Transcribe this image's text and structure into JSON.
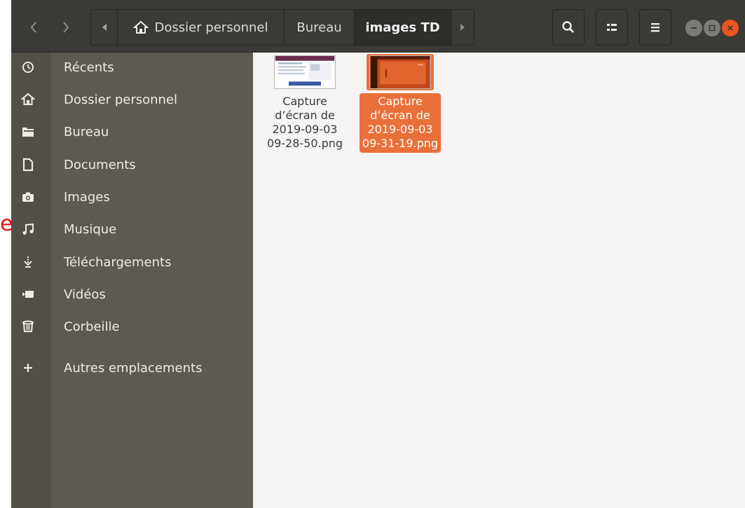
{
  "stray_text": "e",
  "header": {
    "back_label": "‹",
    "forward_label": "›",
    "path": [
      {
        "label": "Dossier personnel"
      },
      {
        "label": "Bureau"
      },
      {
        "label": "images TD"
      }
    ],
    "icons": {
      "search": "search-icon",
      "view": "view-toggle-icon",
      "menu": "hamburger-menu-icon"
    }
  },
  "sidebar": {
    "items": [
      {
        "label": "Récents",
        "icon": "clock-icon"
      },
      {
        "label": "Dossier personnel",
        "icon": "home-icon"
      },
      {
        "label": "Bureau",
        "icon": "folder-icon"
      },
      {
        "label": "Documents",
        "icon": "document-icon"
      },
      {
        "label": "Images",
        "icon": "camera-icon"
      },
      {
        "label": "Musique",
        "icon": "music-note-icon"
      },
      {
        "label": "Téléchargements",
        "icon": "download-icon"
      },
      {
        "label": "Vidéos",
        "icon": "video-icon"
      },
      {
        "label": "Corbeille",
        "icon": "trash-icon"
      },
      {
        "label": "Autres emplacements",
        "icon": "plus-icon"
      }
    ]
  },
  "files": [
    {
      "name": "Capture d’écran de 2019-09-03 09-28-50.png",
      "selected": false
    },
    {
      "name": "Capture d’écran de 2019-09-03 09-31-19.png",
      "selected": true
    }
  ],
  "colors": {
    "accent": "#e9703a",
    "header_bg": "#3b3a37",
    "sidebar_bg": "#5d5a51",
    "close_button": "#e95420"
  }
}
